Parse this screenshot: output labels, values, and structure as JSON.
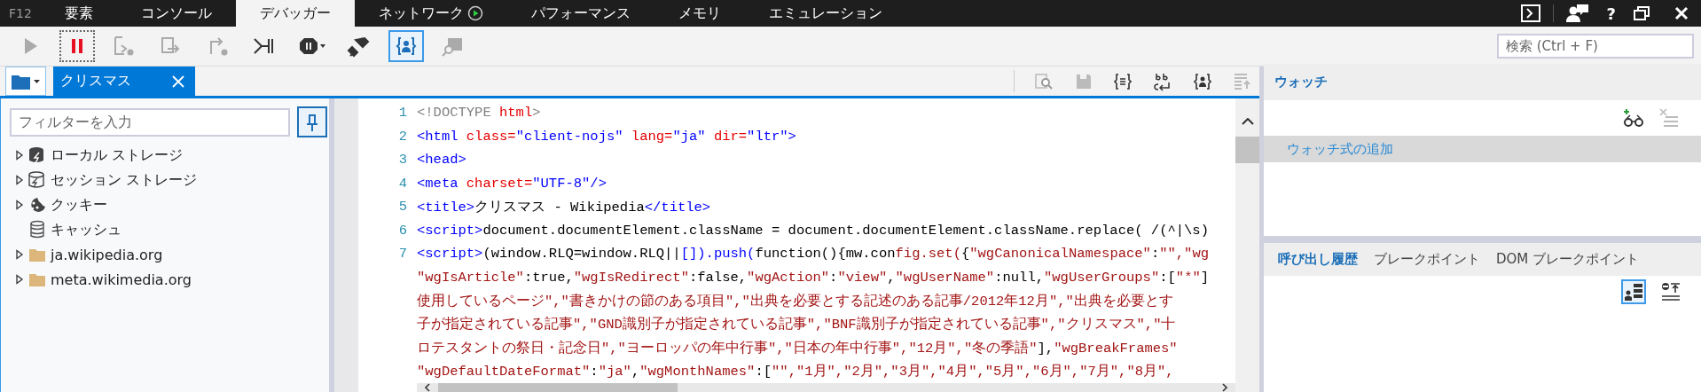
{
  "devtools_bar": {
    "label": "F12",
    "tabs": [
      {
        "label": "要素",
        "selected": false,
        "status_icon": false
      },
      {
        "label": "コンソール",
        "selected": false,
        "status_icon": false
      },
      {
        "label": "デバッガー",
        "selected": true,
        "status_icon": false
      },
      {
        "label": "ネットワーク",
        "selected": false,
        "status_icon": true
      },
      {
        "label": "パフォーマンス",
        "selected": false,
        "status_icon": false
      },
      {
        "label": "メモリ",
        "selected": false,
        "status_icon": false
      },
      {
        "label": "エミュレーション",
        "selected": false,
        "status_icon": false
      }
    ],
    "help_button": "?"
  },
  "toolbar": {
    "buttons": [
      {
        "kind": "continue",
        "disabled": true,
        "on": false
      },
      {
        "kind": "break",
        "disabled": false,
        "on": true
      },
      {
        "kind": "step_into",
        "disabled": true,
        "on": false
      },
      {
        "kind": "step_over",
        "disabled": true,
        "on": false
      },
      {
        "kind": "step_out",
        "disabled": true,
        "on": false
      },
      {
        "kind": "workers",
        "disabled": false,
        "on": false
      },
      {
        "kind": "exceptions",
        "disabled": false,
        "on": false
      },
      {
        "kind": "disconnect",
        "disabled": false,
        "on": false
      },
      {
        "kind": "my_code",
        "disabled": false,
        "on": true
      },
      {
        "kind": "find",
        "disabled": true,
        "on": false
      }
    ],
    "search": {
      "placeholder": "検索 (Ctrl + F)"
    }
  },
  "document_tabs": [
    {
      "label": "クリスマス",
      "selected": true
    }
  ],
  "left_panel": {
    "filter": {
      "placeholder": "フィルターを入力"
    },
    "tree": [
      {
        "label": "ローカル ストレージ",
        "kind": "local",
        "expanded": false
      },
      {
        "label": "セッション ストレージ",
        "kind": "session",
        "expanded": false
      },
      {
        "label": "クッキー",
        "kind": "cookie",
        "expanded": false
      },
      {
        "label": "キャッシュ",
        "kind": "cache"
      },
      {
        "label": "ja.wikipedia.org",
        "kind": "folder",
        "expanded": false
      },
      {
        "label": "meta.wikimedia.org",
        "kind": "folder",
        "expanded": false
      }
    ]
  },
  "code": {
    "lines": [
      {
        "number": "1",
        "segments": [
          {
            "text": "<!DOCTYPE ",
            "kind": "doctype"
          },
          {
            "text": "html",
            "kind": "attr"
          },
          {
            "text": ">",
            "kind": "doctype"
          }
        ]
      },
      {
        "number": "2",
        "segments": [
          {
            "text": "<html ",
            "kind": "tag"
          },
          {
            "text": "class=",
            "kind": "attr"
          },
          {
            "text": "\"client-nojs\" ",
            "kind": "value"
          },
          {
            "text": "lang=",
            "kind": "attr"
          },
          {
            "text": "\"ja\" ",
            "kind": "value"
          },
          {
            "text": "dir=",
            "kind": "attr"
          },
          {
            "text": "\"ltr\">",
            "kind": "value"
          }
        ]
      },
      {
        "number": "3",
        "segments": [
          {
            "text": "<head>",
            "kind": "tag"
          }
        ]
      },
      {
        "number": "4",
        "segments": [
          {
            "text": "<meta ",
            "kind": "tag"
          },
          {
            "text": "charset=",
            "kind": "attr"
          },
          {
            "text": "\"UTF-8\"/>",
            "kind": "value"
          }
        ]
      },
      {
        "number": "5",
        "segments": [
          {
            "text": "<title>",
            "kind": "tag"
          },
          {
            "text": "クリスマス - Wikipedia",
            "kind": "text"
          },
          {
            "text": "</title>",
            "kind": "tag"
          }
        ]
      },
      {
        "number": "6",
        "segments": [
          {
            "text": "<script>",
            "kind": "tag"
          },
          {
            "text": "document.documentElement.className = document.documentElement.className.replace( /(^|\\s)",
            "kind": "text"
          }
        ]
      },
      {
        "number": "7",
        "segments": [
          {
            "text": "<script>",
            "kind": "tag"
          },
          {
            "text": "(window.RLQ=window.RLQ||",
            "kind": "text"
          },
          {
            "text": "[]).push(",
            "kind": "tag"
          },
          {
            "text": "function(){mw.con",
            "kind": "text"
          },
          {
            "text": "fig.set(",
            "kind": "string"
          },
          {
            "text": "{",
            "kind": "text"
          },
          {
            "text": "\"wgCanonicalNamespace\"",
            "kind": "string"
          },
          {
            "text": ":",
            "kind": "text"
          },
          {
            "text": "\"\",\"wg",
            "kind": "string"
          }
        ]
      },
      {
        "segments": [
          {
            "text": "\"wgIsArticle\"",
            "kind": "string"
          },
          {
            "text": ":true,",
            "kind": "text"
          },
          {
            "text": "\"wgIsRedirect\"",
            "kind": "string"
          },
          {
            "text": ":false,",
            "kind": "text"
          },
          {
            "text": "\"wgAction\"",
            "kind": "string"
          },
          {
            "text": ":",
            "kind": "text"
          },
          {
            "text": "\"view\"",
            "kind": "string"
          },
          {
            "text": ",",
            "kind": "text"
          },
          {
            "text": "\"wgUserName\"",
            "kind": "string"
          },
          {
            "text": ":null,",
            "kind": "text"
          },
          {
            "text": "\"wgUserGroups\"",
            "kind": "string"
          },
          {
            "text": ":[",
            "kind": "text"
          },
          {
            "text": "\"*\"",
            "kind": "string"
          },
          {
            "text": "]",
            "kind": "text"
          }
        ]
      },
      {
        "segments": [
          {
            "text": "使用しているページ\",\"書きかけの節のある項目\",\"出典を必要とする記述のある記事/2012年12月\",\"出典を必要とす",
            "kind": "string"
          }
        ]
      },
      {
        "segments": [
          {
            "text": "子が指定されている記事\",\"GND識別子が指定されている記事\",\"BNF識別子が指定されている記事\",\"クリスマス\",\"十",
            "kind": "string"
          }
        ]
      },
      {
        "segments": [
          {
            "text": "ロテスタントの祭日・記念日\",\"ヨーロッパの年中行事\",\"日本の年中行事\",\"12月\",\"冬の季語\"",
            "kind": "string"
          },
          {
            "text": "],",
            "kind": "text"
          },
          {
            "text": "\"wgBreakFrames\"",
            "kind": "string"
          }
        ]
      },
      {
        "segments": [
          {
            "text": "\"wgDefaultDateFormat\"",
            "kind": "string"
          },
          {
            "text": ":",
            "kind": "text"
          },
          {
            "text": "\"ja\"",
            "kind": "string"
          },
          {
            "text": ",",
            "kind": "text"
          },
          {
            "text": "\"wgMonthNames\"",
            "kind": "string"
          },
          {
            "text": ":[",
            "kind": "text"
          },
          {
            "text": "\"\",\"1月\",\"2月\",\"3月\",\"4月\",\"5月\",\"6月\",\"7月\",\"8月\",",
            "kind": "string"
          }
        ]
      }
    ]
  },
  "watch": {
    "title": "ウォッチ",
    "add_row": "ウォッチ式の追加"
  },
  "bottom_tabs": [
    {
      "label": "呼び出し履歴",
      "selected": true
    },
    {
      "label": "ブレークポイント",
      "selected": false
    },
    {
      "label": "DOM ブレークポイント",
      "selected": false
    }
  ]
}
